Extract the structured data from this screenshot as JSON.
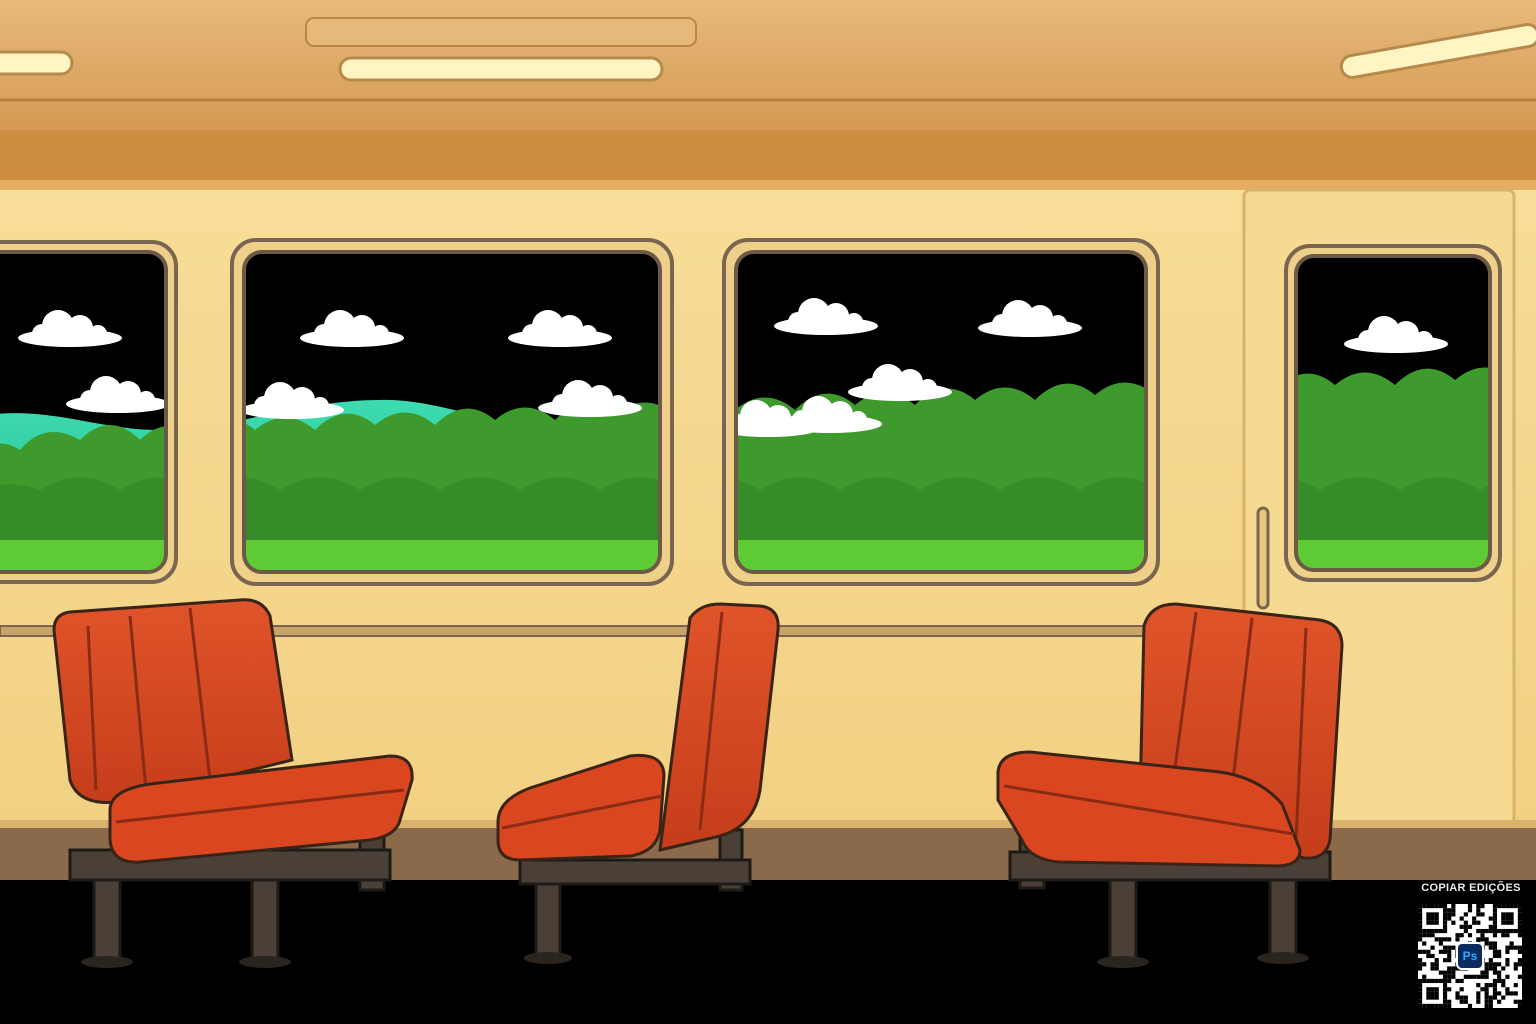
{
  "scene": {
    "title": "",
    "colors": {
      "wall": "#f6d98e",
      "wall_shadow": "#e9c574",
      "ceiling": "#d9a25b",
      "trim": "#c98a3d",
      "window_frame": "#7a6650",
      "sky": "#000000",
      "cloud": "#ffffff",
      "hill": "#2fd0a2",
      "trees": "#3f9a2e",
      "grass": "#5ecb35",
      "seat": "#d9461f",
      "seat_dark": "#a8341a",
      "seat_leg": "#4a4038",
      "floor": "#000000"
    },
    "seats": [
      "seat-left",
      "seat-middle",
      "seat-right"
    ],
    "windows": [
      "window-1",
      "window-2",
      "window-3",
      "window-4"
    ]
  },
  "badge": {
    "label": "COPIAR EDIÇÕES",
    "logo_text": "Ps",
    "icon": "qr-code-icon"
  }
}
